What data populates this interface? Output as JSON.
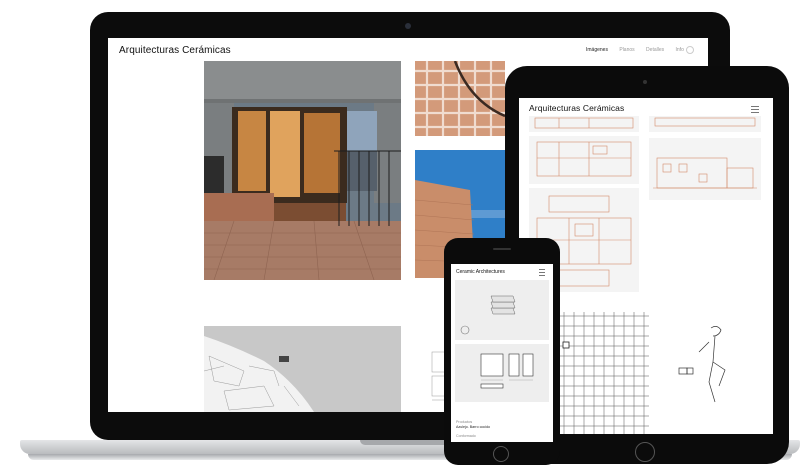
{
  "laptop": {
    "site_title": "Arquitecturas Cerámicas",
    "nav": [
      "Imágenes",
      "Planos",
      "Detalles",
      "Info"
    ]
  },
  "tablet": {
    "site_title": "Arquitecturas Cerámicas"
  },
  "phone": {
    "site_title": "Ceramic Architectures",
    "caption_label": "Productos",
    "caption_value": "Azulejo. Barro cocido",
    "caption_more": "Conformado"
  },
  "colors": {
    "brick": "#c98d6a",
    "sky_dusk": "#7b93ac",
    "sky_day": "#2f7fc8",
    "concrete": "#8a8d8e",
    "interior_light": "#e0a35d"
  }
}
